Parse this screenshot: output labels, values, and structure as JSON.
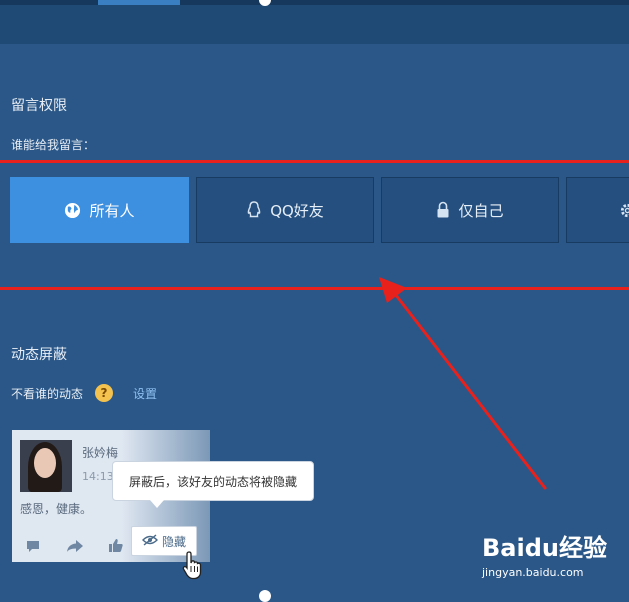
{
  "message_permission": {
    "title": "留言权限",
    "who_label": "谁能给我留言：",
    "options": [
      {
        "label": "所有人",
        "icon": "globe-icon",
        "selected": true
      },
      {
        "label": "QQ好友",
        "icon": "qq-penguin-icon",
        "selected": false
      },
      {
        "label": "仅自己",
        "icon": "lock-icon",
        "selected": false
      },
      {
        "label": "",
        "icon": "gear-icon",
        "selected": false
      }
    ]
  },
  "feed_block": {
    "title": "动态屏蔽",
    "not_see_label": "不看谁的动态",
    "help_glyph": "?",
    "settings_link": "设置"
  },
  "demo_card": {
    "username": "张妗梅",
    "time": "14:13",
    "post_text": "感恩，健康。",
    "tooltip": "屏蔽后，该好友的动态将被隐藏",
    "hide_button": "隐藏"
  },
  "watermark": {
    "logo": "Baidu经验",
    "url": "jingyan.baidu.com"
  },
  "colors": {
    "background": "#2a5787",
    "selected": "#3d8fe0",
    "highlight_red": "#e8211c"
  }
}
